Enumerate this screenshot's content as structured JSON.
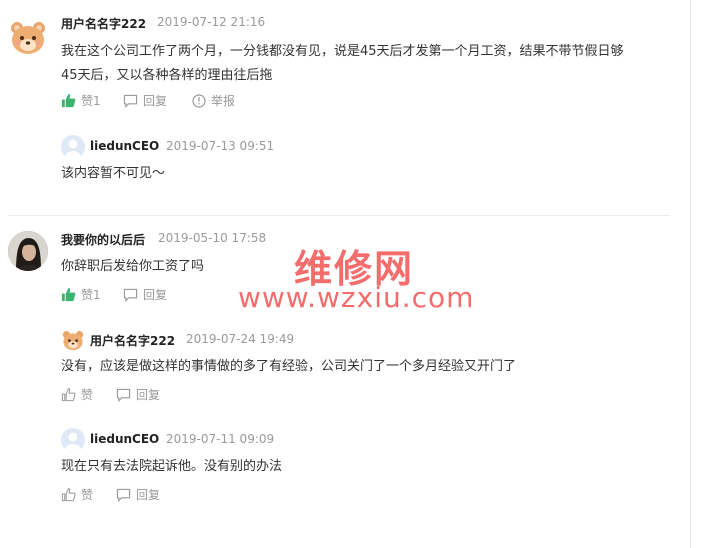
{
  "watermark": {
    "brand": "维修网",
    "url": "www.wzxiu.com"
  },
  "comments": [
    {
      "user": "用户名名字222",
      "time": "2019-07-12 21:16",
      "text_line1": "我在这个公司工作了两个月，一分钱都没有见，说是45天后才发第一个月工资，结果不带节假日够",
      "text_line2": "45天后，又以各种各样的理由往后拖",
      "like_label": "赞1",
      "reply_label": "回复",
      "report_label": "举报",
      "replies": [
        {
          "user": "liedunCEO",
          "time": "2019-07-13 09:51",
          "text": "该内容暂不可见～"
        }
      ]
    },
    {
      "user": "我要你的以后后",
      "time": "2019-05-10 17:58",
      "text": "你辞职后发给你工资了吗",
      "like_label": "赞1",
      "reply_label": "回复",
      "replies": [
        {
          "user": "用户名名字222",
          "time": "2019-07-24 19:49",
          "text": "没有，应该是做这样的事情做的多了有经验，公司关门了一个多月经验又开门了",
          "like_label": "赞",
          "reply_label": "回复"
        },
        {
          "user": "liedunCEO",
          "time": "2019-07-11 09:09",
          "text": "现在只有去法院起诉他。没有别的办法",
          "like_label": "赞",
          "reply_label": "回复"
        }
      ]
    }
  ],
  "colors": {
    "liked_icon": "#3cb371",
    "watermark": "#f03c3c"
  }
}
